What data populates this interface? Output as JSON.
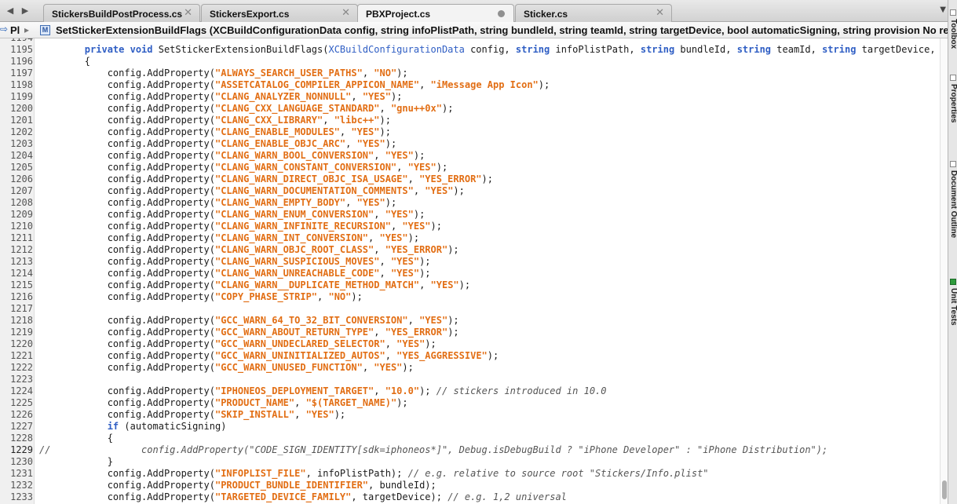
{
  "tabs": [
    {
      "label": "StickersBuildPostProcess.cs",
      "active": false,
      "modified": false
    },
    {
      "label": "StickersExport.cs",
      "active": false,
      "modified": false
    },
    {
      "label": "PBXProject.cs",
      "active": true,
      "modified": true
    },
    {
      "label": "Sticker.cs",
      "active": false,
      "modified": false
    }
  ],
  "nav": {
    "back_icon": "back-arrow-icon",
    "forward_icon": "forward-arrow-icon",
    "back_glyph": "◀",
    "forward_glyph": "▶",
    "overflow_glyph": "▼",
    "close_glyph": "✕"
  },
  "breadcrumb": {
    "project": "Pl",
    "method_icon_letter": "M",
    "method": "SetStickerExtensionBuildFlags (XCBuildConfigurationData config, string infoPlistPath, string bundleId, string teamId, string targetDevice, bool automaticSigning, string provision No re"
  },
  "side_panels": [
    "Toolbox",
    "Properties",
    "Document Outline",
    "Unit Tests"
  ],
  "editor": {
    "current_line": "1229",
    "lines": [
      {
        "n": "1194",
        "tokens": []
      },
      {
        "n": "1195",
        "tokens": [
          [
            "d",
            "        "
          ],
          [
            "k",
            "private void"
          ],
          [
            "d",
            " SetStickerExtensionBuildFlags("
          ],
          [
            "t",
            "XCBuildConfigurationData"
          ],
          [
            "d",
            " config, "
          ],
          [
            "k",
            "string"
          ],
          [
            "d",
            " infoPlistPath, "
          ],
          [
            "k",
            "string"
          ],
          [
            "d",
            " bundleId, "
          ],
          [
            "k",
            "string"
          ],
          [
            "d",
            " teamId, "
          ],
          [
            "k",
            "string"
          ],
          [
            "d",
            " targetDevice,"
          ]
        ]
      },
      {
        "n": "1196",
        "tokens": [
          [
            "d",
            "        {"
          ]
        ]
      },
      {
        "n": "1197",
        "tokens": [
          [
            "d",
            "            config.AddProperty("
          ],
          [
            "s",
            "\"ALWAYS_SEARCH_USER_PATHS\""
          ],
          [
            "d",
            ", "
          ],
          [
            "s",
            "\"NO\""
          ],
          [
            "d",
            ");"
          ]
        ]
      },
      {
        "n": "1198",
        "tokens": [
          [
            "d",
            "            config.AddProperty("
          ],
          [
            "s",
            "\"ASSETCATALOG_COMPILER_APPICON_NAME\""
          ],
          [
            "d",
            ", "
          ],
          [
            "s",
            "\"iMessage App Icon\""
          ],
          [
            "d",
            ");"
          ]
        ]
      },
      {
        "n": "1199",
        "tokens": [
          [
            "d",
            "            config.AddProperty("
          ],
          [
            "s",
            "\"CLANG_ANALYZER_NONNULL\""
          ],
          [
            "d",
            ", "
          ],
          [
            "s",
            "\"YES\""
          ],
          [
            "d",
            ");"
          ]
        ]
      },
      {
        "n": "1200",
        "tokens": [
          [
            "d",
            "            config.AddProperty("
          ],
          [
            "s",
            "\"CLANG_CXX_LANGUAGE_STANDARD\""
          ],
          [
            "d",
            ", "
          ],
          [
            "s",
            "\"gnu++0x\""
          ],
          [
            "d",
            ");"
          ]
        ]
      },
      {
        "n": "1201",
        "tokens": [
          [
            "d",
            "            config.AddProperty("
          ],
          [
            "s",
            "\"CLANG_CXX_LIBRARY\""
          ],
          [
            "d",
            ", "
          ],
          [
            "s",
            "\"libc++\""
          ],
          [
            "d",
            ");"
          ]
        ]
      },
      {
        "n": "1202",
        "tokens": [
          [
            "d",
            "            config.AddProperty("
          ],
          [
            "s",
            "\"CLANG_ENABLE_MODULES\""
          ],
          [
            "d",
            ", "
          ],
          [
            "s",
            "\"YES\""
          ],
          [
            "d",
            ");"
          ]
        ]
      },
      {
        "n": "1203",
        "tokens": [
          [
            "d",
            "            config.AddProperty("
          ],
          [
            "s",
            "\"CLANG_ENABLE_OBJC_ARC\""
          ],
          [
            "d",
            ", "
          ],
          [
            "s",
            "\"YES\""
          ],
          [
            "d",
            ");"
          ]
        ]
      },
      {
        "n": "1204",
        "tokens": [
          [
            "d",
            "            config.AddProperty("
          ],
          [
            "s",
            "\"CLANG_WARN_BOOL_CONVERSION\""
          ],
          [
            "d",
            ", "
          ],
          [
            "s",
            "\"YES\""
          ],
          [
            "d",
            ");"
          ]
        ]
      },
      {
        "n": "1205",
        "tokens": [
          [
            "d",
            "            config.AddProperty("
          ],
          [
            "s",
            "\"CLANG_WARN_CONSTANT_CONVERSION\""
          ],
          [
            "d",
            ", "
          ],
          [
            "s",
            "\"YES\""
          ],
          [
            "d",
            ");"
          ]
        ]
      },
      {
        "n": "1206",
        "tokens": [
          [
            "d",
            "            config.AddProperty("
          ],
          [
            "s",
            "\"CLANG_WARN_DIRECT_OBJC_ISA_USAGE\""
          ],
          [
            "d",
            ", "
          ],
          [
            "s",
            "\"YES_ERROR\""
          ],
          [
            "d",
            ");"
          ]
        ]
      },
      {
        "n": "1207",
        "tokens": [
          [
            "d",
            "            config.AddProperty("
          ],
          [
            "s",
            "\"CLANG_WARN_DOCUMENTATION_COMMENTS\""
          ],
          [
            "d",
            ", "
          ],
          [
            "s",
            "\"YES\""
          ],
          [
            "d",
            ");"
          ]
        ]
      },
      {
        "n": "1208",
        "tokens": [
          [
            "d",
            "            config.AddProperty("
          ],
          [
            "s",
            "\"CLANG_WARN_EMPTY_BODY\""
          ],
          [
            "d",
            ", "
          ],
          [
            "s",
            "\"YES\""
          ],
          [
            "d",
            ");"
          ]
        ]
      },
      {
        "n": "1209",
        "tokens": [
          [
            "d",
            "            config.AddProperty("
          ],
          [
            "s",
            "\"CLANG_WARN_ENUM_CONVERSION\""
          ],
          [
            "d",
            ", "
          ],
          [
            "s",
            "\"YES\""
          ],
          [
            "d",
            ");"
          ]
        ]
      },
      {
        "n": "1210",
        "tokens": [
          [
            "d",
            "            config.AddProperty("
          ],
          [
            "s",
            "\"CLANG_WARN_INFINITE_RECURSION\""
          ],
          [
            "d",
            ", "
          ],
          [
            "s",
            "\"YES\""
          ],
          [
            "d",
            ");"
          ]
        ]
      },
      {
        "n": "1211",
        "tokens": [
          [
            "d",
            "            config.AddProperty("
          ],
          [
            "s",
            "\"CLANG_WARN_INT_CONVERSION\""
          ],
          [
            "d",
            ", "
          ],
          [
            "s",
            "\"YES\""
          ],
          [
            "d",
            ");"
          ]
        ]
      },
      {
        "n": "1212",
        "tokens": [
          [
            "d",
            "            config.AddProperty("
          ],
          [
            "s",
            "\"CLANG_WARN_OBJC_ROOT_CLASS\""
          ],
          [
            "d",
            ", "
          ],
          [
            "s",
            "\"YES_ERROR\""
          ],
          [
            "d",
            ");"
          ]
        ]
      },
      {
        "n": "1213",
        "tokens": [
          [
            "d",
            "            config.AddProperty("
          ],
          [
            "s",
            "\"CLANG_WARN_SUSPICIOUS_MOVES\""
          ],
          [
            "d",
            ", "
          ],
          [
            "s",
            "\"YES\""
          ],
          [
            "d",
            ");"
          ]
        ]
      },
      {
        "n": "1214",
        "tokens": [
          [
            "d",
            "            config.AddProperty("
          ],
          [
            "s",
            "\"CLANG_WARN_UNREACHABLE_CODE\""
          ],
          [
            "d",
            ", "
          ],
          [
            "s",
            "\"YES\""
          ],
          [
            "d",
            ");"
          ]
        ]
      },
      {
        "n": "1215",
        "tokens": [
          [
            "d",
            "            config.AddProperty("
          ],
          [
            "s",
            "\"CLANG_WARN__DUPLICATE_METHOD_MATCH\""
          ],
          [
            "d",
            ", "
          ],
          [
            "s",
            "\"YES\""
          ],
          [
            "d",
            ");"
          ]
        ]
      },
      {
        "n": "1216",
        "tokens": [
          [
            "d",
            "            config.AddProperty("
          ],
          [
            "s",
            "\"COPY_PHASE_STRIP\""
          ],
          [
            "d",
            ", "
          ],
          [
            "s",
            "\"NO\""
          ],
          [
            "d",
            ");"
          ]
        ]
      },
      {
        "n": "1217",
        "tokens": []
      },
      {
        "n": "1218",
        "tokens": [
          [
            "d",
            "            config.AddProperty("
          ],
          [
            "s",
            "\"GCC_WARN_64_TO_32_BIT_CONVERSION\""
          ],
          [
            "d",
            ", "
          ],
          [
            "s",
            "\"YES\""
          ],
          [
            "d",
            ");"
          ]
        ]
      },
      {
        "n": "1219",
        "tokens": [
          [
            "d",
            "            config.AddProperty("
          ],
          [
            "s",
            "\"GCC_WARN_ABOUT_RETURN_TYPE\""
          ],
          [
            "d",
            ", "
          ],
          [
            "s",
            "\"YES_ERROR\""
          ],
          [
            "d",
            ");"
          ]
        ]
      },
      {
        "n": "1220",
        "tokens": [
          [
            "d",
            "            config.AddProperty("
          ],
          [
            "s",
            "\"GCC_WARN_UNDECLARED_SELECTOR\""
          ],
          [
            "d",
            ", "
          ],
          [
            "s",
            "\"YES\""
          ],
          [
            "d",
            ");"
          ]
        ]
      },
      {
        "n": "1221",
        "tokens": [
          [
            "d",
            "            config.AddProperty("
          ],
          [
            "s",
            "\"GCC_WARN_UNINITIALIZED_AUTOS\""
          ],
          [
            "d",
            ", "
          ],
          [
            "s",
            "\"YES_AGGRESSIVE\""
          ],
          [
            "d",
            ");"
          ]
        ]
      },
      {
        "n": "1222",
        "tokens": [
          [
            "d",
            "            config.AddProperty("
          ],
          [
            "s",
            "\"GCC_WARN_UNUSED_FUNCTION\""
          ],
          [
            "d",
            ", "
          ],
          [
            "s",
            "\"YES\""
          ],
          [
            "d",
            ");"
          ]
        ]
      },
      {
        "n": "1223",
        "tokens": []
      },
      {
        "n": "1224",
        "tokens": [
          [
            "d",
            "            config.AddProperty("
          ],
          [
            "s",
            "\"IPHONEOS_DEPLOYMENT_TARGET\""
          ],
          [
            "d",
            ", "
          ],
          [
            "s",
            "\"10.0\""
          ],
          [
            "d",
            "); "
          ],
          [
            "c",
            "// stickers introduced in 10.0"
          ]
        ]
      },
      {
        "n": "1225",
        "tokens": [
          [
            "d",
            "            config.AddProperty("
          ],
          [
            "s",
            "\"PRODUCT_NAME\""
          ],
          [
            "d",
            ", "
          ],
          [
            "s",
            "\"$(TARGET_NAME)\""
          ],
          [
            "d",
            ");"
          ]
        ]
      },
      {
        "n": "1226",
        "tokens": [
          [
            "d",
            "            config.AddProperty("
          ],
          [
            "s",
            "\"SKIP_INSTALL\""
          ],
          [
            "d",
            ", "
          ],
          [
            "s",
            "\"YES\""
          ],
          [
            "d",
            ");"
          ]
        ]
      },
      {
        "n": "1227",
        "tokens": [
          [
            "d",
            "            "
          ],
          [
            "k",
            "if"
          ],
          [
            "d",
            " (automaticSigning)"
          ]
        ]
      },
      {
        "n": "1228",
        "tokens": [
          [
            "d",
            "            {"
          ]
        ]
      },
      {
        "n": "1229",
        "tokens": [
          [
            "c",
            "//                config.AddProperty(\"CODE_SIGN_IDENTITY[sdk=iphoneos*]\", Debug.isDebugBuild ? \"iPhone Developer\" : \"iPhone Distribution\");"
          ]
        ]
      },
      {
        "n": "1230",
        "tokens": [
          [
            "d",
            "            }"
          ]
        ]
      },
      {
        "n": "1231",
        "tokens": [
          [
            "d",
            "            config.AddProperty("
          ],
          [
            "s",
            "\"INFOPLIST_FILE\""
          ],
          [
            "d",
            ", infoPlistPath); "
          ],
          [
            "c",
            "// e.g. relative to source root \"Stickers/Info.plist\""
          ]
        ]
      },
      {
        "n": "1232",
        "tokens": [
          [
            "d",
            "            config.AddProperty("
          ],
          [
            "s",
            "\"PRODUCT_BUNDLE_IDENTIFIER\""
          ],
          [
            "d",
            ", bundleId);"
          ]
        ]
      },
      {
        "n": "1233",
        "tokens": [
          [
            "d",
            "            config.AddProperty("
          ],
          [
            "s",
            "\"TARGETED_DEVICE_FAMILY\""
          ],
          [
            "d",
            ", targetDevice); "
          ],
          [
            "c",
            "// e.g. 1,2 universal"
          ]
        ]
      }
    ]
  }
}
